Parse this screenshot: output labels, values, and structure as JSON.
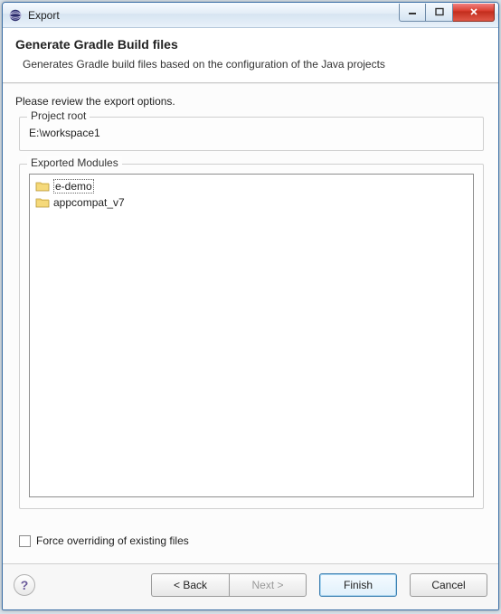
{
  "window": {
    "title": "Export"
  },
  "header": {
    "title": "Generate Gradle Build files",
    "description": "Generates Gradle build files based on the configuration of the Java projects"
  },
  "body": {
    "review_text": "Please review the export options.",
    "project_root_group": "Project root",
    "project_root_value": "E:\\workspace1",
    "exported_modules_group": "Exported Modules",
    "modules": [
      {
        "label": "e-demo",
        "selected": true
      },
      {
        "label": "appcompat_v7",
        "selected": false
      }
    ],
    "force_override_label": "Force overriding of existing files",
    "force_override_checked": false
  },
  "footer": {
    "help_glyph": "?",
    "back_label": "< Back",
    "next_label": "Next >",
    "finish_label": "Finish",
    "cancel_label": "Cancel"
  }
}
